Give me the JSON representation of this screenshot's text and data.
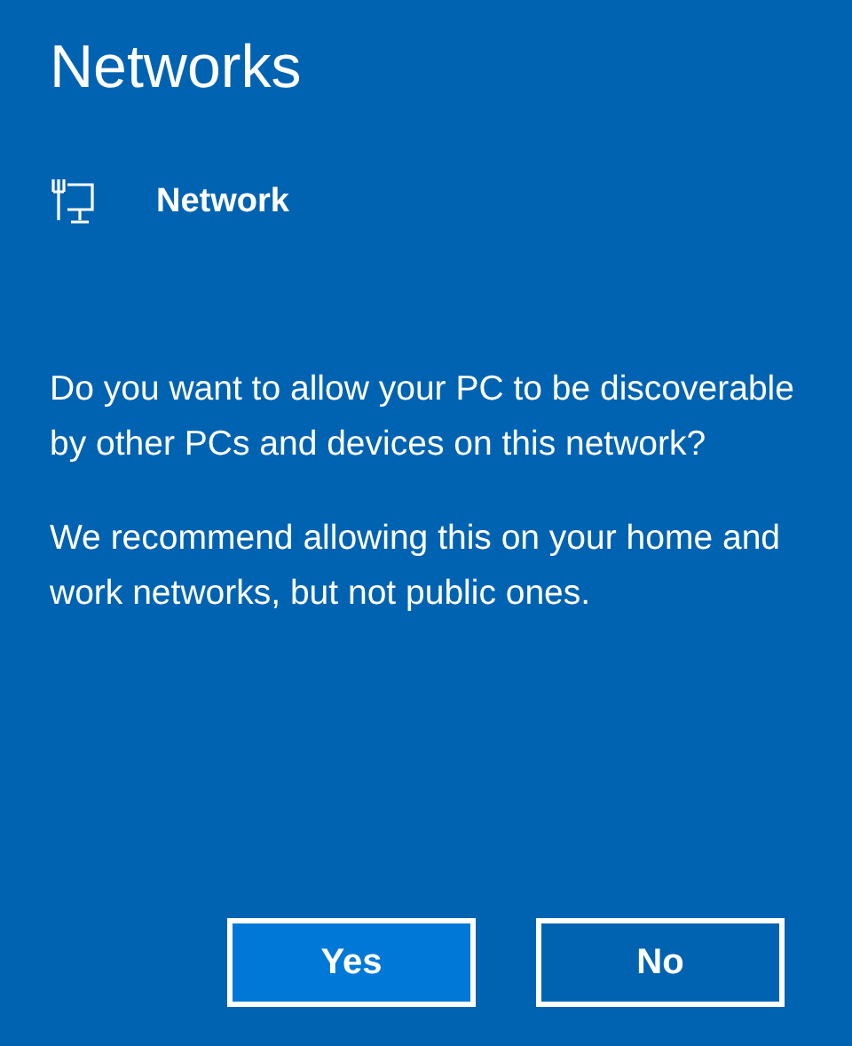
{
  "title": "Networks",
  "network": {
    "name": "Network"
  },
  "paragraphs": [
    "Do you want to allow your PC to be discoverable by other PCs and devices on this network?",
    "We recommend allowing this on your home and work networks, but not public ones."
  ],
  "buttons": [
    {
      "label": "Yes",
      "kind": "primary"
    },
    {
      "label": "No",
      "kind": "secondary"
    }
  ]
}
